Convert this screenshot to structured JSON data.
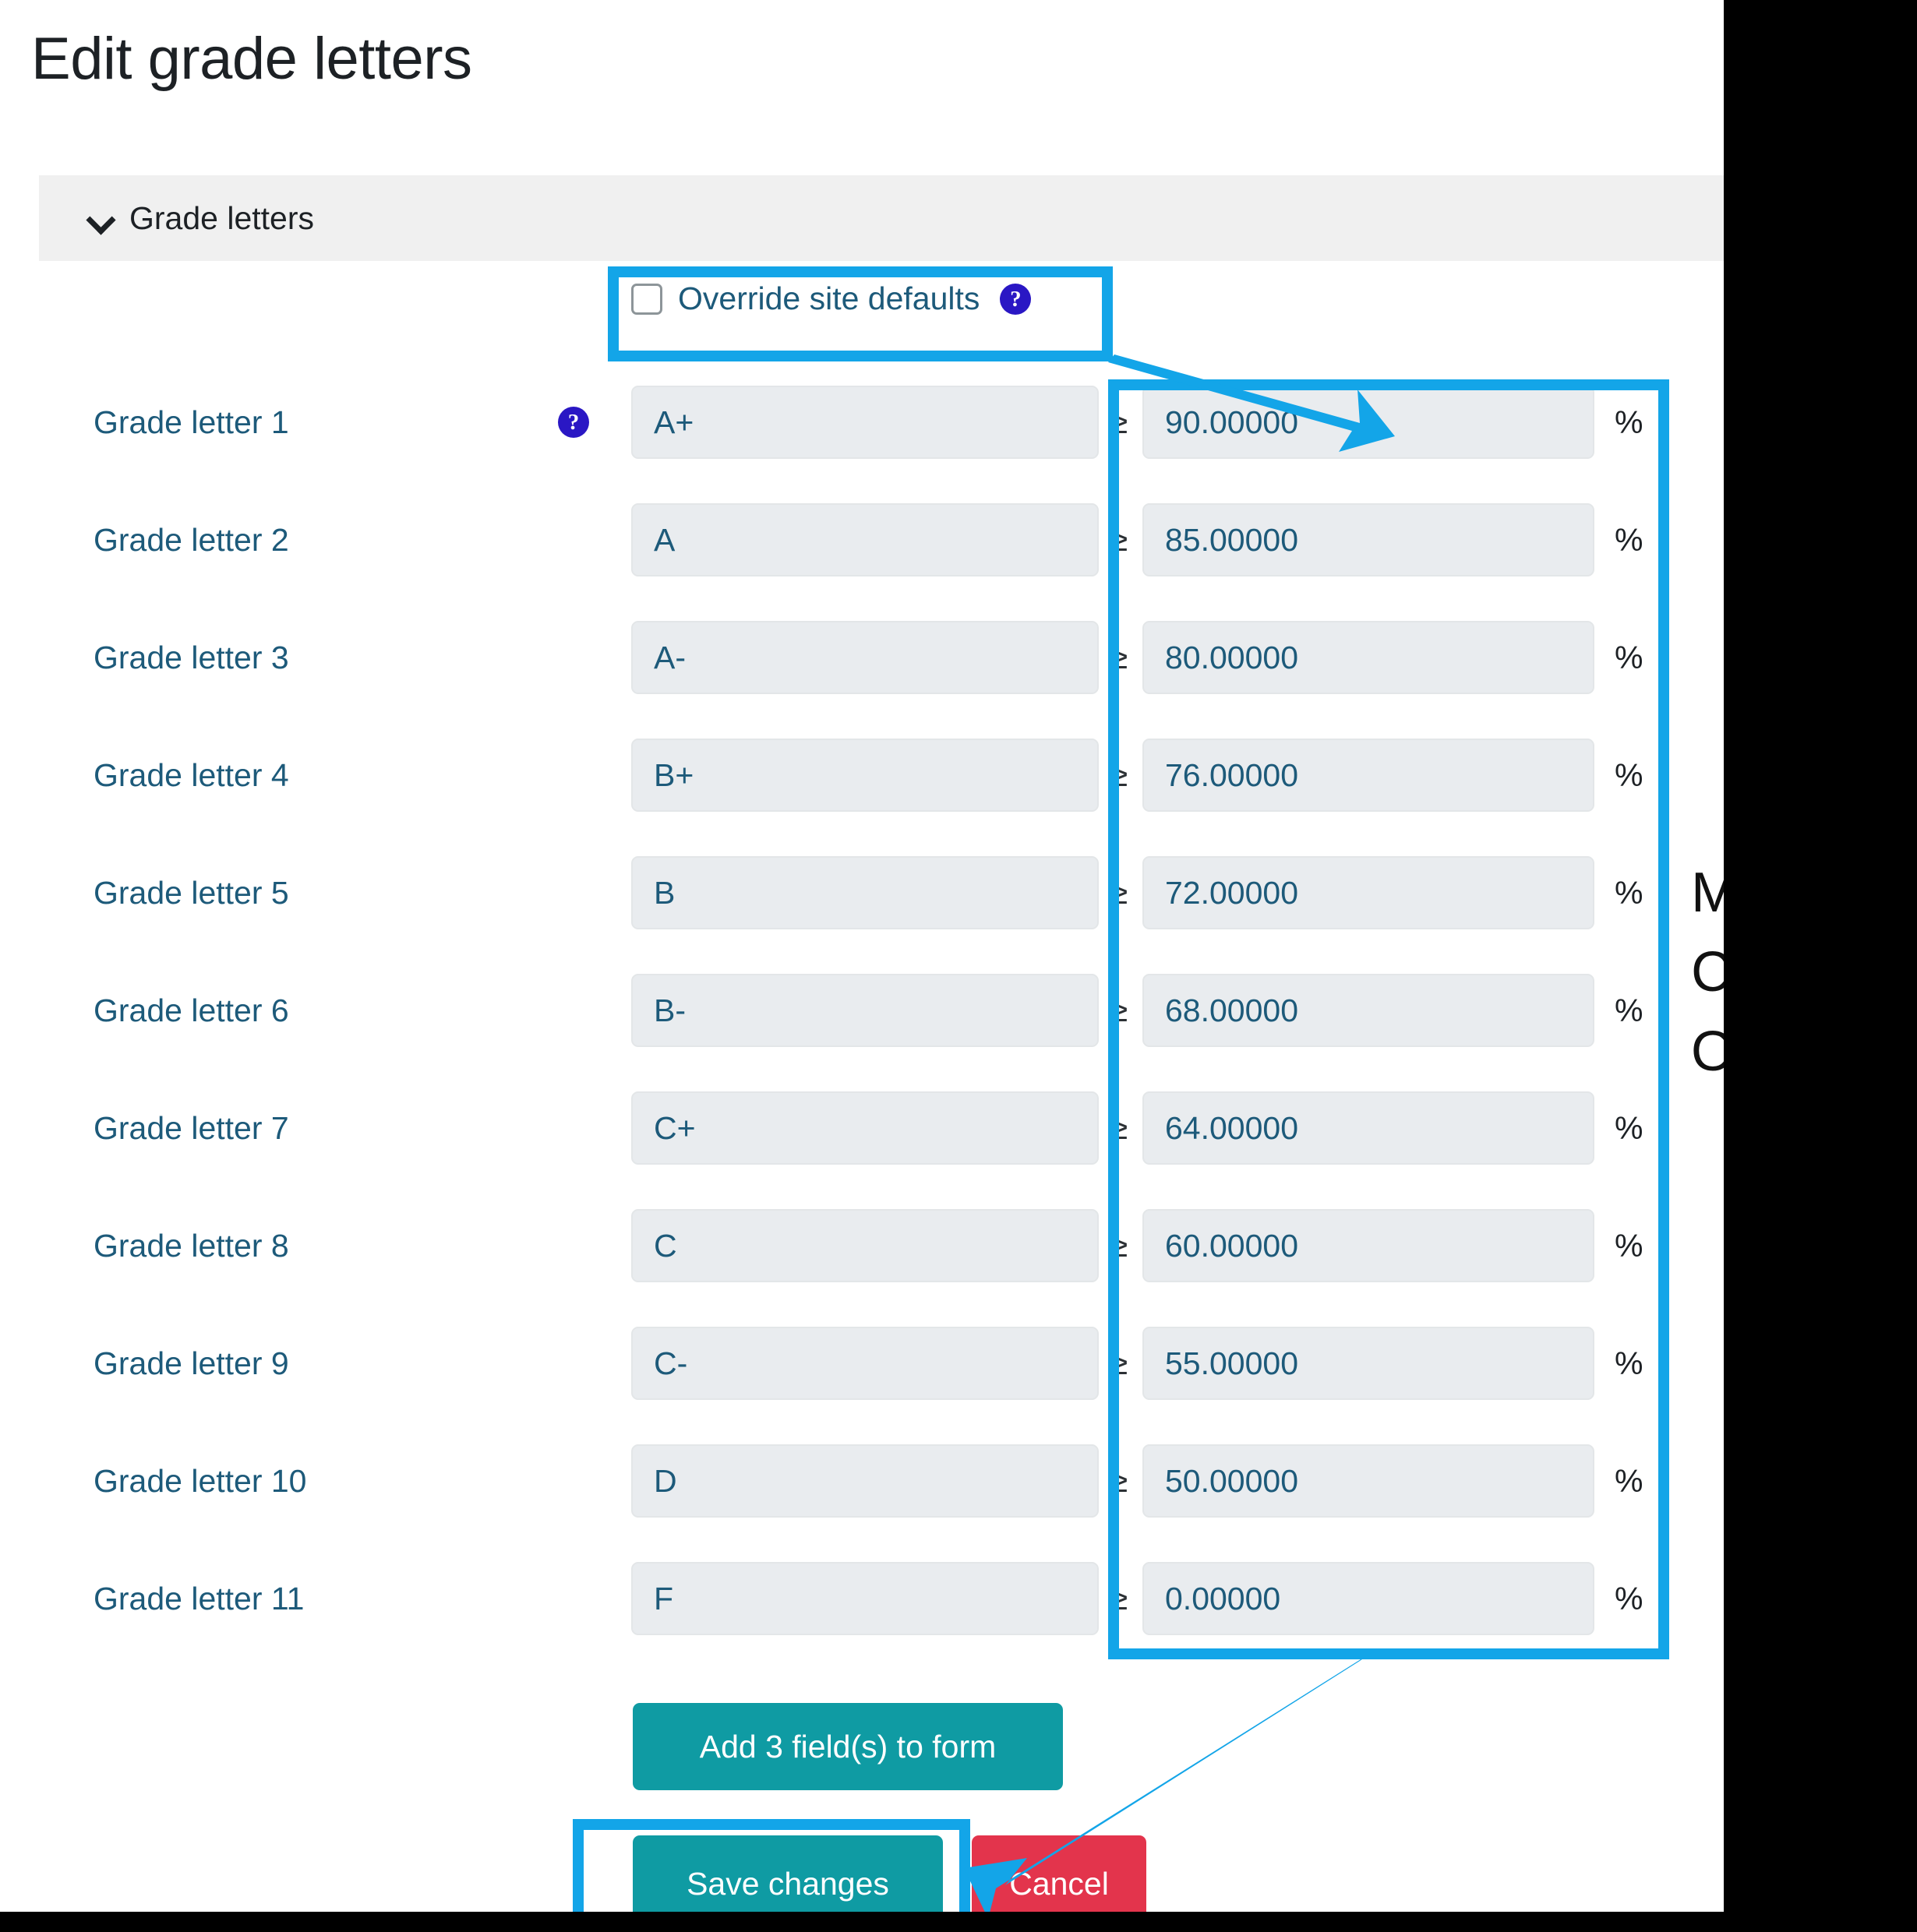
{
  "page": {
    "title": "Edit grade letters"
  },
  "section": {
    "chevron": "chevron-down-icon",
    "label": "Grade letters"
  },
  "override": {
    "checkbox_checked": false,
    "label": "Override site defaults",
    "help_icon": "help-circle-icon",
    "help_glyph": "?"
  },
  "table": {
    "gte_symbol": "≥",
    "percent_symbol": "%",
    "rows": [
      {
        "label": "Grade letter 1",
        "letter": "A+",
        "value": "90.00000",
        "has_help": true
      },
      {
        "label": "Grade letter 2",
        "letter": "A",
        "value": "85.00000",
        "has_help": false
      },
      {
        "label": "Grade letter 3",
        "letter": "A-",
        "value": "80.00000",
        "has_help": false
      },
      {
        "label": "Grade letter 4",
        "letter": "B+",
        "value": "76.00000",
        "has_help": false
      },
      {
        "label": "Grade letter 5",
        "letter": "B",
        "value": "72.00000",
        "has_help": false
      },
      {
        "label": "Grade letter 6",
        "letter": "B-",
        "value": "68.00000",
        "has_help": false
      },
      {
        "label": "Grade letter 7",
        "letter": "C+",
        "value": "64.00000",
        "has_help": false
      },
      {
        "label": "Grade letter 8",
        "letter": "C",
        "value": "60.00000",
        "has_help": false
      },
      {
        "label": "Grade letter 9",
        "letter": "C-",
        "value": "55.00000",
        "has_help": false
      },
      {
        "label": "Grade letter 10",
        "letter": "D",
        "value": "50.00000",
        "has_help": false
      },
      {
        "label": "Grade letter 11",
        "letter": "F",
        "value": "0.00000",
        "has_help": false
      }
    ]
  },
  "buttons": {
    "add_fields": "Add 3 field(s) to form",
    "save": "Save changes",
    "cancel": "Cancel"
  },
  "side_text": "M\nC\nO",
  "colors": {
    "annotation": "#13a5e8",
    "teal": "#0f9ba3",
    "red": "#e3344c",
    "help_badge": "#2a17c4",
    "link_text": "#1d5a7a",
    "field_bg": "#e9ecef",
    "section_bg": "#f0f0f0"
  }
}
